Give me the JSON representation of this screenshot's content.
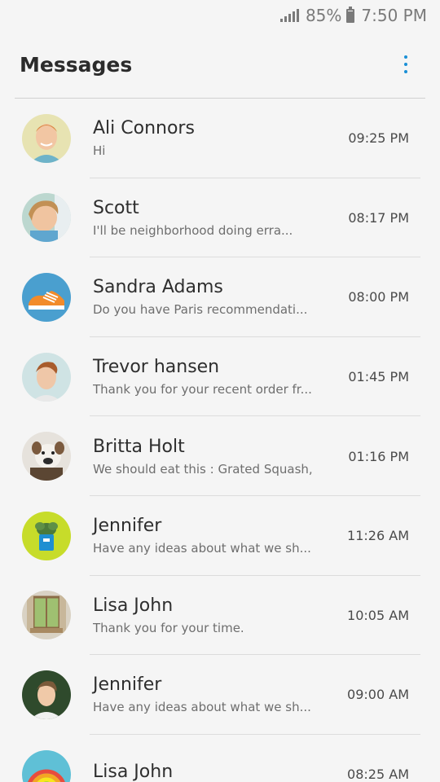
{
  "status_bar": {
    "battery": "85%",
    "battery_level": 0.85,
    "time": "7:50 PM",
    "icons": [
      "signal-icon",
      "battery-icon"
    ]
  },
  "header": {
    "title": "Messages",
    "menu_icon": "more-vert-icon"
  },
  "colors": {
    "accent": "#1a8fd6",
    "background": "#f5f5f5",
    "divider": "#dcdcdc"
  },
  "conversations": [
    {
      "name": "Ali Connors",
      "preview": "Hi",
      "time": "09:25 PM",
      "avatar": "person-avatar"
    },
    {
      "name": "Scott",
      "preview": "I'll be neighborhood doing erra...",
      "time": "08:17 PM",
      "avatar": "child-avatar"
    },
    {
      "name": "Sandra Adams",
      "preview": "Do you have Paris recommendati...",
      "time": "08:00 PM",
      "avatar": "sneaker-avatar"
    },
    {
      "name": "Trevor hansen",
      "preview": "Thank you for your recent order fr...",
      "time": "01:45 PM",
      "avatar": "person-avatar"
    },
    {
      "name": "Britta Holt",
      "preview": "We should eat this : Grated Squash,",
      "time": "01:16 PM",
      "avatar": "dog-avatar"
    },
    {
      "name": "Jennifer",
      "preview": "Have any ideas about what we sh...",
      "time": "11:26 AM",
      "avatar": "cactus-avatar"
    },
    {
      "name": "Lisa John",
      "preview": "Thank you for your time.",
      "time": "10:05 AM",
      "avatar": "window-avatar"
    },
    {
      "name": "Jennifer",
      "preview": "Have any ideas about what we sh...",
      "time": "09:00 AM",
      "avatar": "person-avatar"
    },
    {
      "name": "Lisa John",
      "preview": "",
      "time": "08:25 AM",
      "avatar": "rainbow-avatar"
    }
  ]
}
